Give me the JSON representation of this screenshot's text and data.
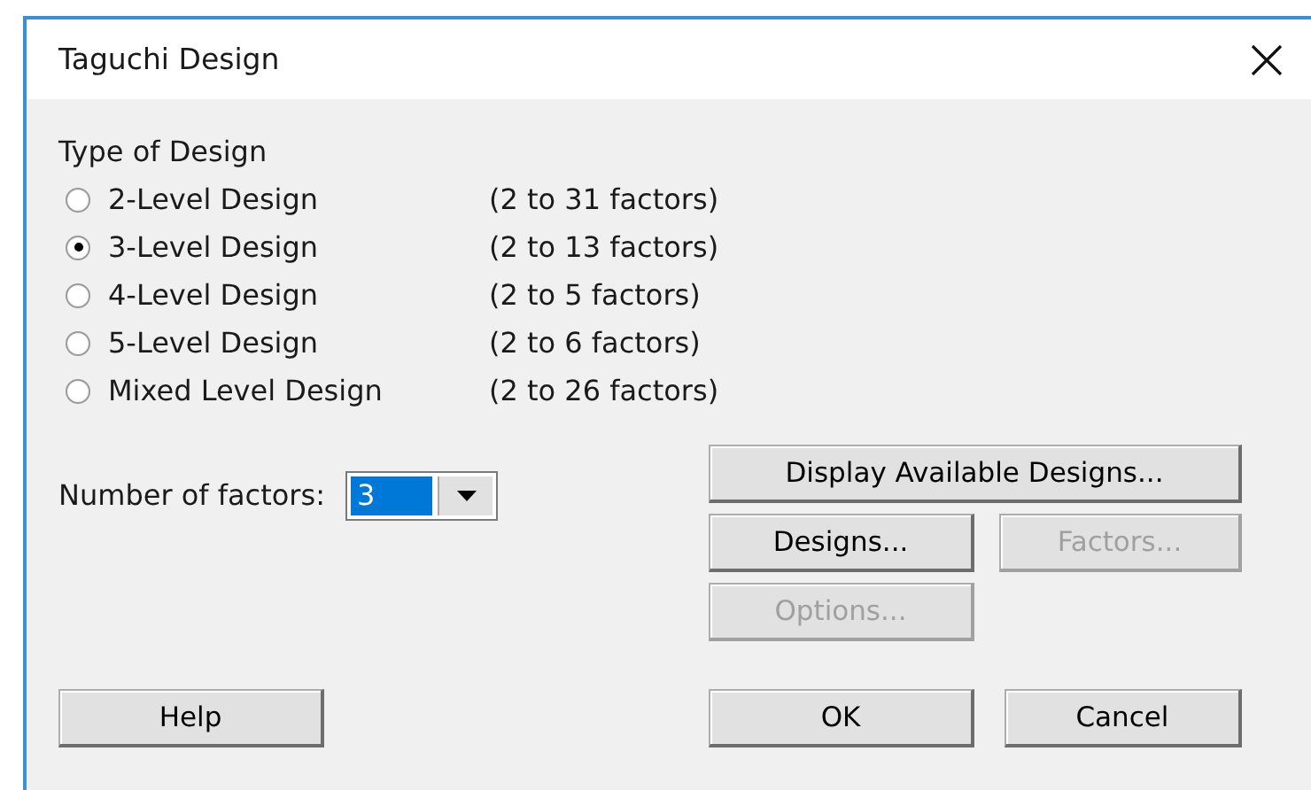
{
  "window": {
    "title": "Taguchi Design"
  },
  "design_type": {
    "label": "Type of Design",
    "options": [
      {
        "label": "2-Level Design",
        "range": "(2 to 31 factors)",
        "selected": false
      },
      {
        "label": "3-Level Design",
        "range": "(2 to 13 factors)",
        "selected": true
      },
      {
        "label": "4-Level Design",
        "range": "(2 to 5 factors)",
        "selected": false
      },
      {
        "label": "5-Level Design",
        "range": "(2 to 6 factors)",
        "selected": false
      },
      {
        "label": "Mixed Level Design",
        "range": "(2 to 26 factors)",
        "selected": false
      }
    ]
  },
  "number_of_factors": {
    "label": "Number of factors:",
    "value": "3"
  },
  "side_buttons": [
    {
      "label": "Display Available Designs...",
      "disabled": false
    },
    {
      "label": "Designs...",
      "disabled": false
    },
    {
      "label": "Factors...",
      "disabled": true
    },
    {
      "label": "Options...",
      "disabled": true
    }
  ],
  "footer_buttons": [
    {
      "label": "Help",
      "disabled": false
    },
    {
      "label": "OK",
      "disabled": false
    },
    {
      "label": "Cancel",
      "disabled": false
    }
  ]
}
